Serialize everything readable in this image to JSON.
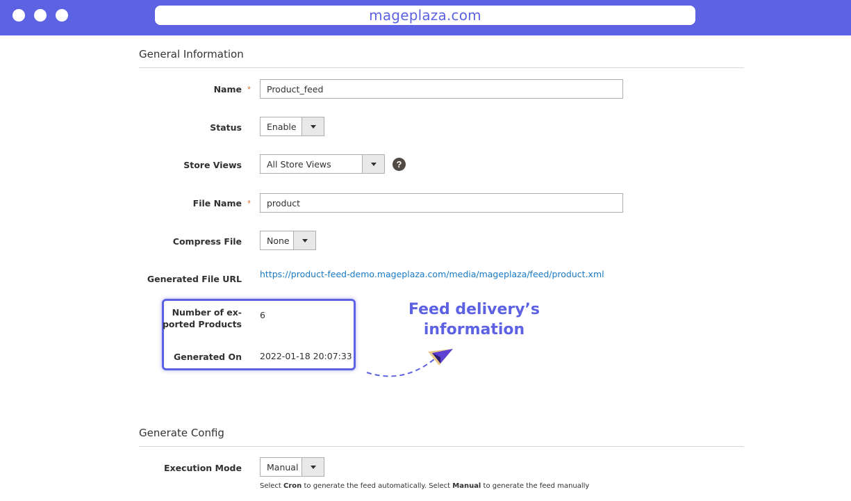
{
  "browser": {
    "url": "mageplaza.com"
  },
  "general": {
    "title": "General Information",
    "name": {
      "label": "Name",
      "required_mark": "*",
      "value": "Product_feed"
    },
    "status": {
      "label": "Status",
      "selected": "Enable"
    },
    "store_views": {
      "label": "Store Views",
      "selected": "All Store Views",
      "help": "?"
    },
    "file_name": {
      "label": "File Name",
      "required_mark": "*",
      "value": "product"
    },
    "compress_file": {
      "label": "Compress File",
      "selected": "None"
    },
    "generated_url": {
      "label": "Generated File URL",
      "value": "https://product-feed-demo.mageplaza.com/media/mageplaza/feed/product.xml"
    },
    "exported_products": {
      "label_line1": "Number of ex-",
      "label_line2": "ported Products",
      "value": "6"
    },
    "generated_on": {
      "label": "Generated On",
      "value": "2022-01-18 20:07:33"
    }
  },
  "callout": {
    "line1": "Feed delivery’s",
    "line2": "information"
  },
  "generate_config": {
    "title": "Generate Config",
    "execution_mode": {
      "label": "Execution Mode",
      "selected": "Manual"
    },
    "note": {
      "part1": "Select ",
      "cron": "Cron",
      "part2": " to generate the feed automatically. Select ",
      "manual": "Manual",
      "part3": " to generate the feed manually"
    }
  },
  "colors": {
    "brand": "#5d62e3",
    "link": "#1979c3",
    "required": "#e27b3c"
  },
  "icons": {
    "help": "question-circle-icon",
    "dropdown": "chevron-down-icon",
    "annotation": "paper-plane-icon"
  }
}
